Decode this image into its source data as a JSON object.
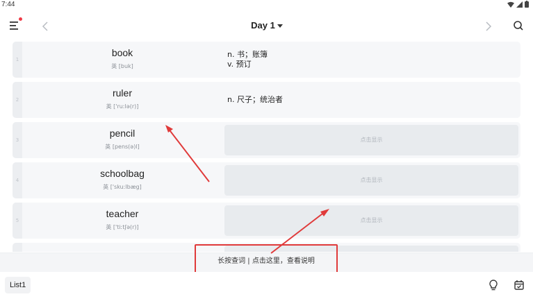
{
  "status_bar": {
    "time": "7:44"
  },
  "header": {
    "title": "Day 1"
  },
  "words": [
    {
      "index": "1",
      "word": "book",
      "phonetic": "英 [buk]",
      "definitions": [
        "n. 书；账簿",
        "v. 预订"
      ],
      "revealed": true
    },
    {
      "index": "2",
      "word": "ruler",
      "phonetic": "英 ['ruːlə(r)]",
      "definitions": [
        "n. 尺子；统治者"
      ],
      "revealed": true
    },
    {
      "index": "3",
      "word": "pencil",
      "phonetic": "英 [pens(ə)l]",
      "reveal_label": "点击显示",
      "revealed": false
    },
    {
      "index": "4",
      "word": "schoolbag",
      "phonetic": "英 ['skuːlbæg]",
      "reveal_label": "点击显示",
      "revealed": false
    },
    {
      "index": "5",
      "word": "teacher",
      "phonetic": "英 ['tiːtʃə(r)]",
      "reveal_label": "点击显示",
      "revealed": false
    }
  ],
  "hint": {
    "text": "长按查词 | 点击这里，查看说明"
  },
  "bottom": {
    "list_label": "List1"
  },
  "colors": {
    "accent_red": "#e03a3a",
    "row_bg": "#f6f7f9",
    "reveal_bg": "#e8ebee",
    "notification_dot": "#ef3b46"
  },
  "icons": [
    "menu-icon",
    "chevron-left-icon",
    "chevron-right-icon",
    "search-icon",
    "lightbulb-icon",
    "calendar-icon",
    "wifi-icon",
    "signal-icon",
    "battery-icon"
  ]
}
